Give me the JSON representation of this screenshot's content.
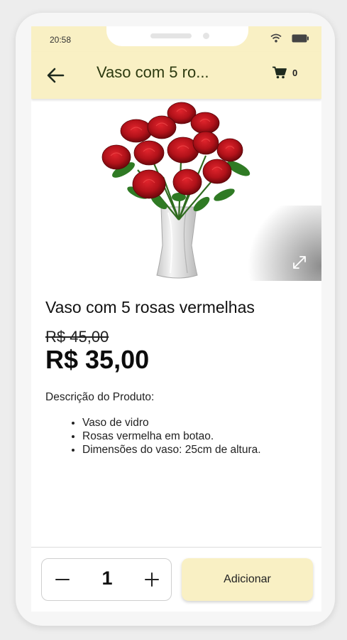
{
  "status_bar": {
    "time": "20:58"
  },
  "app_bar": {
    "title": "Vaso com 5 ro...",
    "cart_count": "0"
  },
  "product": {
    "title": "Vaso com 5 rosas vermelhas",
    "old_price": "R$ 45,00",
    "price": "R$ 35,00",
    "description_label": "Descrição do Produto:",
    "description_items": [
      "Vaso de vidro",
      "Rosas vermelha em botao.",
      "Dimensões do vaso: 25cm de altura."
    ]
  },
  "purchase": {
    "quantity": "1",
    "add_label": "Adicionar"
  },
  "colors": {
    "appbar_bg": "#f9f0c4",
    "add_button_bg": "#f9f0c4",
    "appbar_title": "#2d3a10"
  }
}
